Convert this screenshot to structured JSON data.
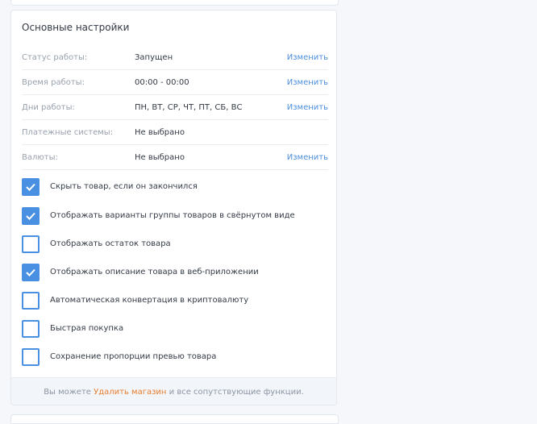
{
  "section": {
    "title": "Основные настройки"
  },
  "rows": [
    {
      "label": "Статус работы:",
      "value": "Запущен",
      "action": "Изменить"
    },
    {
      "label": "Время работы:",
      "value": "00:00 - 00:00",
      "action": "Изменить"
    },
    {
      "label": "Дни работы:",
      "value": "ПН, ВТ, СР, ЧТ, ПТ, СБ, ВС",
      "action": "Изменить"
    },
    {
      "label": "Платежные системы:",
      "value": "Не выбрано"
    },
    {
      "label": "Валюты:",
      "value": "Не выбрано",
      "action": "Изменить"
    }
  ],
  "options": [
    {
      "label": "Скрыть товар, если он закончился",
      "checked": true
    },
    {
      "label": "Отображать варианты группы товаров в свёрнутом виде",
      "checked": true
    },
    {
      "label": "Отображать остаток товара",
      "checked": false
    },
    {
      "label": "Отображать описание товара в веб-приложении",
      "checked": true
    },
    {
      "label": "Автоматическая конвертация в криптовалюту",
      "checked": false
    },
    {
      "label": "Быстрая покупка",
      "checked": false
    },
    {
      "label": "Сохранение пропорции превью товара",
      "checked": false
    }
  ],
  "footer": {
    "prefix": "Вы можете",
    "link": "Удалить магазин",
    "suffix": "и все сопутствующие функции."
  },
  "colors": {
    "accent": "#4a90e2",
    "link": "#4d8fdb",
    "danger_link": "#e87e2f"
  }
}
